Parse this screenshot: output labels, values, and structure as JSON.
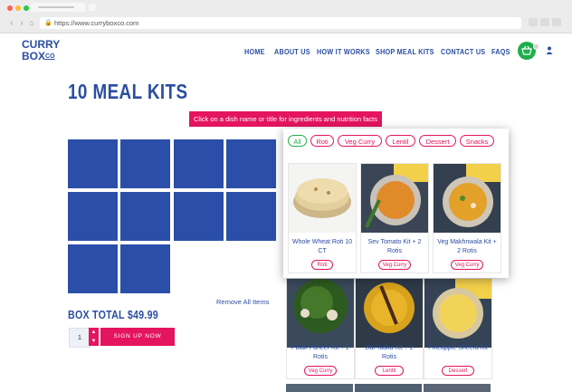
{
  "browser": {
    "url": "https://www.curryboxco.com"
  },
  "logo": {
    "line1": "CURRY",
    "line2": "BOX",
    "line2_suffix": "CO"
  },
  "nav": {
    "items": [
      "HOME",
      "ABOUT US",
      "HOW IT WORKS",
      "SHOP MEAL KITS",
      "CONTACT US",
      "FAQS"
    ]
  },
  "page": {
    "title": "10 MEAL KITS",
    "hint": "Click on a dish name or title for ingredients and nutrition facts",
    "remove_all": "Remove All Items",
    "box_total": "BOX TOTAL $49.99",
    "quantity": "1",
    "signup": "SIGN UP NOW"
  },
  "filters": [
    "All",
    "Roti",
    "Veg Curry",
    "Lentil",
    "Dessert",
    "Snacks"
  ],
  "popup_products": [
    {
      "name": "Whole Wheat Roti 10 CT",
      "tag": "Roti"
    },
    {
      "name": "Sev Tomato Kit + 2 Rotis",
      "tag": "Veg Curry"
    },
    {
      "name": "Veg Makhnwala Kit + 2 Rotis",
      "tag": "Veg Curry"
    }
  ],
  "products": [
    {
      "name": "Palak Paneer Kit + 2 Rotis",
      "tag": "Veg Curry"
    },
    {
      "name": "Dal Tadka Kit + 2 Rotis",
      "tag": "Lentil"
    },
    {
      "name": "Pineapple Sheera Kit",
      "tag": "Dessert"
    }
  ],
  "colors": {
    "brand_blue": "#2b4ea2",
    "slot_blue": "#2b4fa8",
    "accent_pink": "#e4145f",
    "cart_green": "#1fae4b"
  },
  "icons": {
    "cart": "basket-icon",
    "user": "user-icon",
    "lock": "lock-icon"
  }
}
